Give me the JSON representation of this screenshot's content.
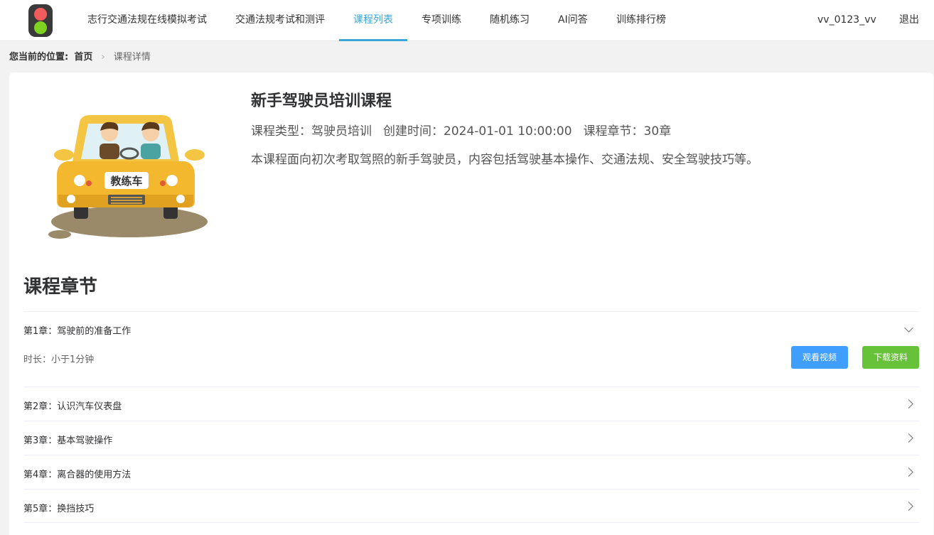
{
  "nav": {
    "items": [
      {
        "label": "志行交通法规在线模拟考试"
      },
      {
        "label": "交通法规考试和测评"
      },
      {
        "label": "课程列表"
      },
      {
        "label": "专项训练"
      },
      {
        "label": "随机练习"
      },
      {
        "label": "AI问答"
      },
      {
        "label": "训练排行榜"
      }
    ],
    "active_index": 2,
    "username": "vv_0123_vv",
    "logout": "退出"
  },
  "breadcrumb": {
    "label": "您当前的位置:",
    "home": "首页",
    "current": "课程详情"
  },
  "course": {
    "title": "新手驾驶员培训课程",
    "type_text": "课程类型：驾驶员培训",
    "created_text": "创建时间：2024-01-01 10:00:00",
    "chapters_text": "课程章节：30章",
    "description": "本课程面向初次考取驾照的新手驾驶员，内容包括驾驶基本操作、交通法规、安全驾驶技巧等。",
    "image_sign": "教练车"
  },
  "chapters_section": {
    "title": "课程章节",
    "items": [
      {
        "title": "第1章：驾驶前的准备工作",
        "expanded": true,
        "duration": "时长：小于1分钟",
        "watch_label": "观看视频",
        "download_label": "下载资料"
      },
      {
        "title": "第2章：认识汽车仪表盘",
        "expanded": false
      },
      {
        "title": "第3章：基本驾驶操作",
        "expanded": false
      },
      {
        "title": "第4章：离合器的使用方法",
        "expanded": false
      },
      {
        "title": "第5章：换挡技巧",
        "expanded": false
      }
    ]
  },
  "colors": {
    "accent": "#3aa7d8",
    "watch_button": "#409eff",
    "download_button": "#67c23a"
  }
}
